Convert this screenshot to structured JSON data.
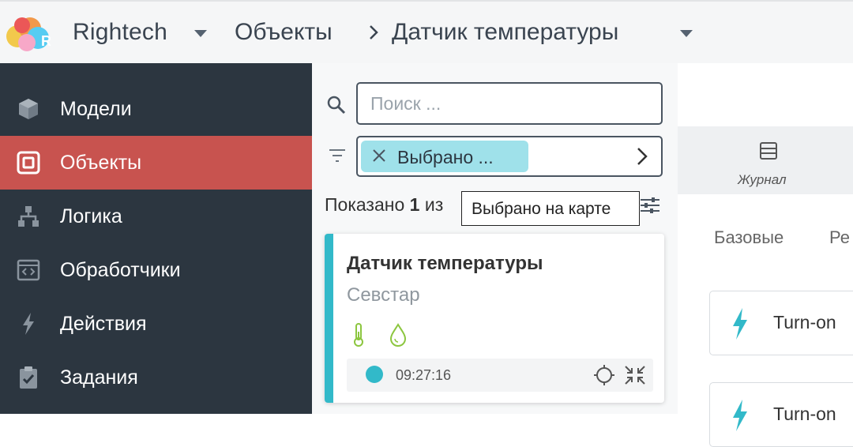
{
  "header": {
    "app_name": "Rightech",
    "breadcrumb": [
      "Объекты",
      "Датчик температуры"
    ]
  },
  "sidebar": {
    "items": [
      {
        "label": "Модели",
        "icon": "cube-icon"
      },
      {
        "label": "Объекты",
        "icon": "object-icon",
        "active": true
      },
      {
        "label": "Логика",
        "icon": "hierarchy-icon"
      },
      {
        "label": "Обработчики",
        "icon": "code-window-icon"
      },
      {
        "label": "Действия",
        "icon": "bolt-icon"
      },
      {
        "label": "Задания",
        "icon": "clipboard-check-icon"
      }
    ]
  },
  "filter_panel": {
    "search_placeholder": "Поиск ...",
    "filter_chip_label": "Выбрано ...",
    "count_prefix": "Показано ",
    "count_value": "1",
    "count_suffix": " из",
    "tooltip": "Выбрано на карте"
  },
  "object_card": {
    "title": "Датчик температуры",
    "subtitle": "Севстар",
    "time": "09:27:16",
    "status_color": "#32b9c9"
  },
  "right_panel": {
    "journal_label": "Журнал",
    "subtabs": [
      "Базовые",
      "Ре"
    ],
    "actions": [
      "Turn-on",
      "Turn-on"
    ]
  },
  "colors": {
    "sidebar_bg": "#2c3640",
    "active_item": "#c8534f",
    "accent": "#32b9c9",
    "chip": "#9fe1ea",
    "sensor_icons": "#8cc63f"
  }
}
